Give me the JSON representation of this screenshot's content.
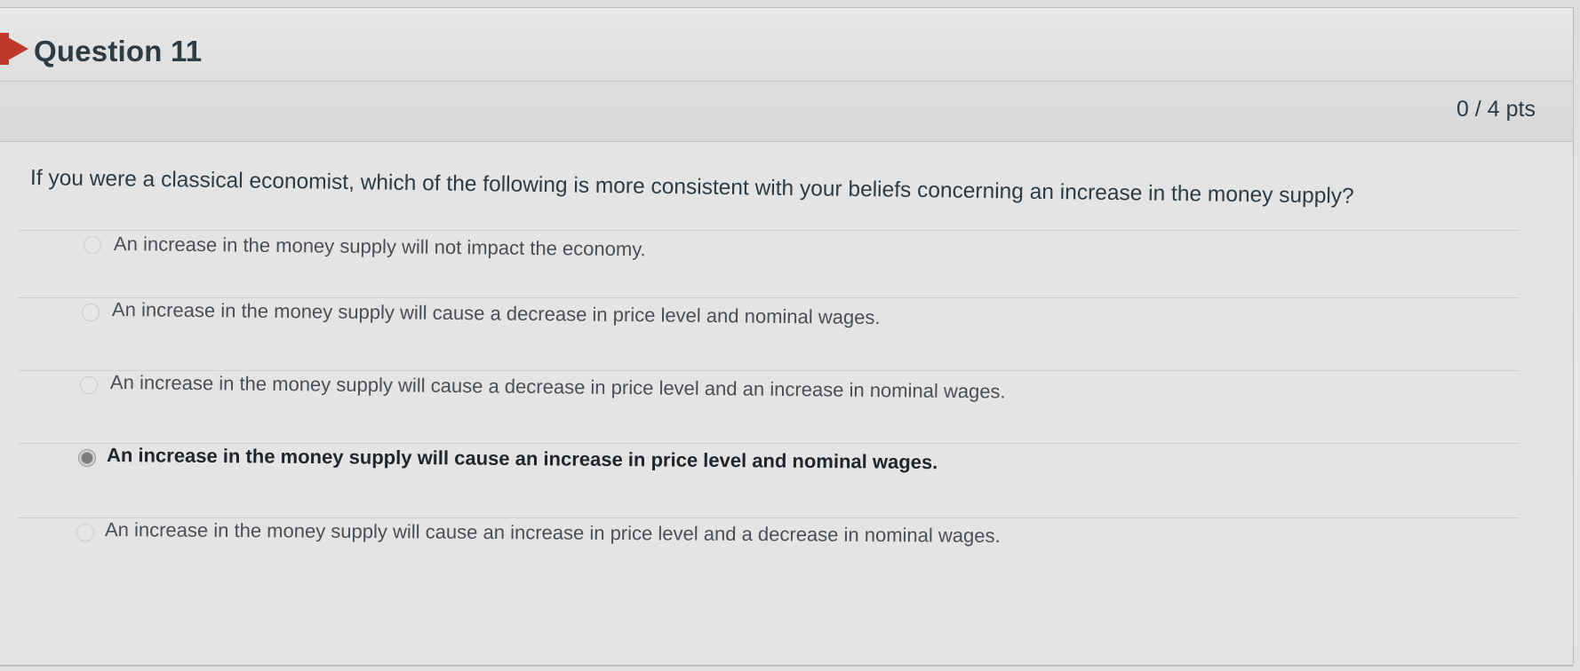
{
  "question": {
    "title": "Question 11",
    "points": "0 / 4 pts",
    "text": "If you were a classical economist, which of the following is more consistent with your beliefs concerning an increase in the money supply?"
  },
  "answers": [
    {
      "label": "An increase in the money supply will not impact the economy.",
      "selected": false
    },
    {
      "label": "An increase in the money supply will cause a decrease in price level and nominal wages.",
      "selected": false
    },
    {
      "label": "An increase in the money supply will cause a decrease in price level and an increase in nominal wages.",
      "selected": false
    },
    {
      "label": "An increase in the money supply will cause an increase in price level and nominal wages.",
      "selected": true
    },
    {
      "label": "An increase in the money supply will cause an increase in price level and a decrease in nominal wages.",
      "selected": false
    }
  ],
  "colors": {
    "flag": "#c0392b",
    "text": "#2d3b45"
  },
  "icons": {
    "flag": "flag-icon",
    "radio": "radio-button"
  }
}
